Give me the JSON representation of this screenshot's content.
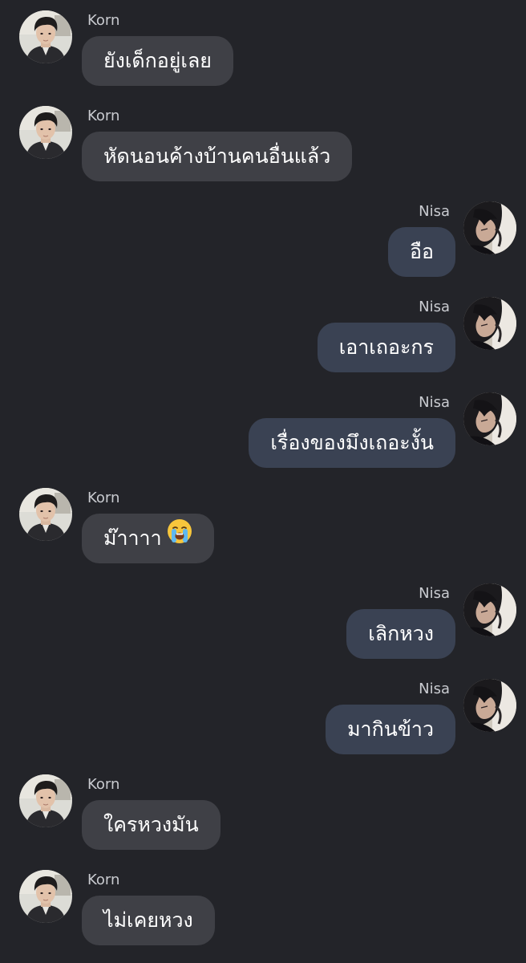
{
  "chat": {
    "messages": [
      {
        "side": "left",
        "sender": "Korn",
        "text": "ยังเด็กอยู่เลย"
      },
      {
        "side": "left",
        "sender": "Korn",
        "text": "หัดนอนค้างบ้านคนอื่นแล้ว"
      },
      {
        "side": "right",
        "sender": "Nisa",
        "text": "อือ"
      },
      {
        "side": "right",
        "sender": "Nisa",
        "text": "เอาเถอะกร"
      },
      {
        "side": "right",
        "sender": "Nisa",
        "text": "เรื่องของมึงเถอะงั้น"
      },
      {
        "side": "left",
        "sender": "Korn",
        "text": "ม๊าาาา",
        "emoji": "loudly-crying-face"
      },
      {
        "side": "right",
        "sender": "Nisa",
        "text": "เลิกหวง"
      },
      {
        "side": "right",
        "sender": "Nisa",
        "text": "มากินข้าว"
      },
      {
        "side": "left",
        "sender": "Korn",
        "text": "ใครหวงมัน"
      },
      {
        "side": "left",
        "sender": "Korn",
        "text": "ไม่เคยหวง"
      }
    ]
  },
  "colors": {
    "background": "#232429",
    "left_bubble": "#3f4046",
    "right_bubble": "#3a4253",
    "sender_name": "#c9cbd0",
    "message_text": "#ffffff"
  }
}
